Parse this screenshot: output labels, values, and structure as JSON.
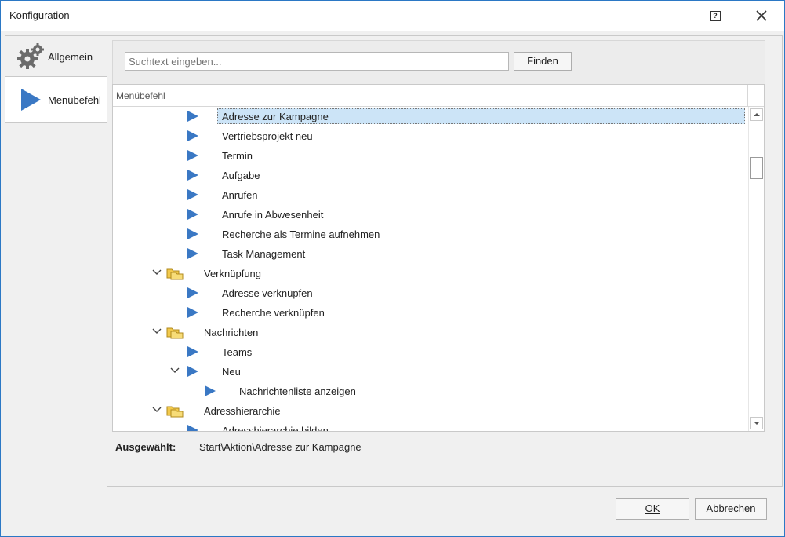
{
  "window": {
    "title": "Konfiguration",
    "help_icon": "help-icon",
    "close_icon": "close-icon"
  },
  "tabs": [
    {
      "label": "Allgemein",
      "icon": "gear-icon"
    },
    {
      "label": "Menübefehl",
      "icon": "play-arrow-icon",
      "active": true
    }
  ],
  "search": {
    "placeholder": "Suchtext eingeben...",
    "value": "",
    "find_label": "Finden"
  },
  "tree": {
    "column_header": "Menübefehl",
    "rows": [
      {
        "label": "Adresse zur Kampagne",
        "type": "command",
        "selected": true
      },
      {
        "label": "Vertriebsprojekt neu",
        "type": "command"
      },
      {
        "label": "Termin",
        "type": "command"
      },
      {
        "label": "Aufgabe",
        "type": "command"
      },
      {
        "label": "Anrufen",
        "type": "command"
      },
      {
        "label": "Anrufe in Abwesenheit",
        "type": "command"
      },
      {
        "label": "Recherche als Termine aufnehmen",
        "type": "command"
      },
      {
        "label": "Task Management",
        "type": "command"
      },
      {
        "label": "Verknüpfung",
        "type": "folder",
        "expanded": true
      },
      {
        "label": "Adresse verknüpfen",
        "type": "command"
      },
      {
        "label": "Recherche verknüpfen",
        "type": "command"
      },
      {
        "label": "Nachrichten",
        "type": "folder",
        "expanded": true
      },
      {
        "label": "Teams",
        "type": "command"
      },
      {
        "label": "Neu",
        "type": "command",
        "expanded": true
      },
      {
        "label": "Nachrichtenliste anzeigen",
        "type": "command"
      },
      {
        "label": "Adresshierarchie",
        "type": "folder",
        "expanded": true
      },
      {
        "label": "Adresshierarchie bilden",
        "type": "command"
      }
    ]
  },
  "status": {
    "selected_label": "Ausgewählt:",
    "selected_value": "Start\\Aktion\\Adresse zur Kampagne"
  },
  "buttons": {
    "ok": "OK",
    "cancel": "Abbrechen"
  },
  "colors": {
    "accent_arrow": "#3a78c4",
    "selection": "#cce4f7",
    "folder": "#f2c94c",
    "window_border": "#2b78c5"
  }
}
